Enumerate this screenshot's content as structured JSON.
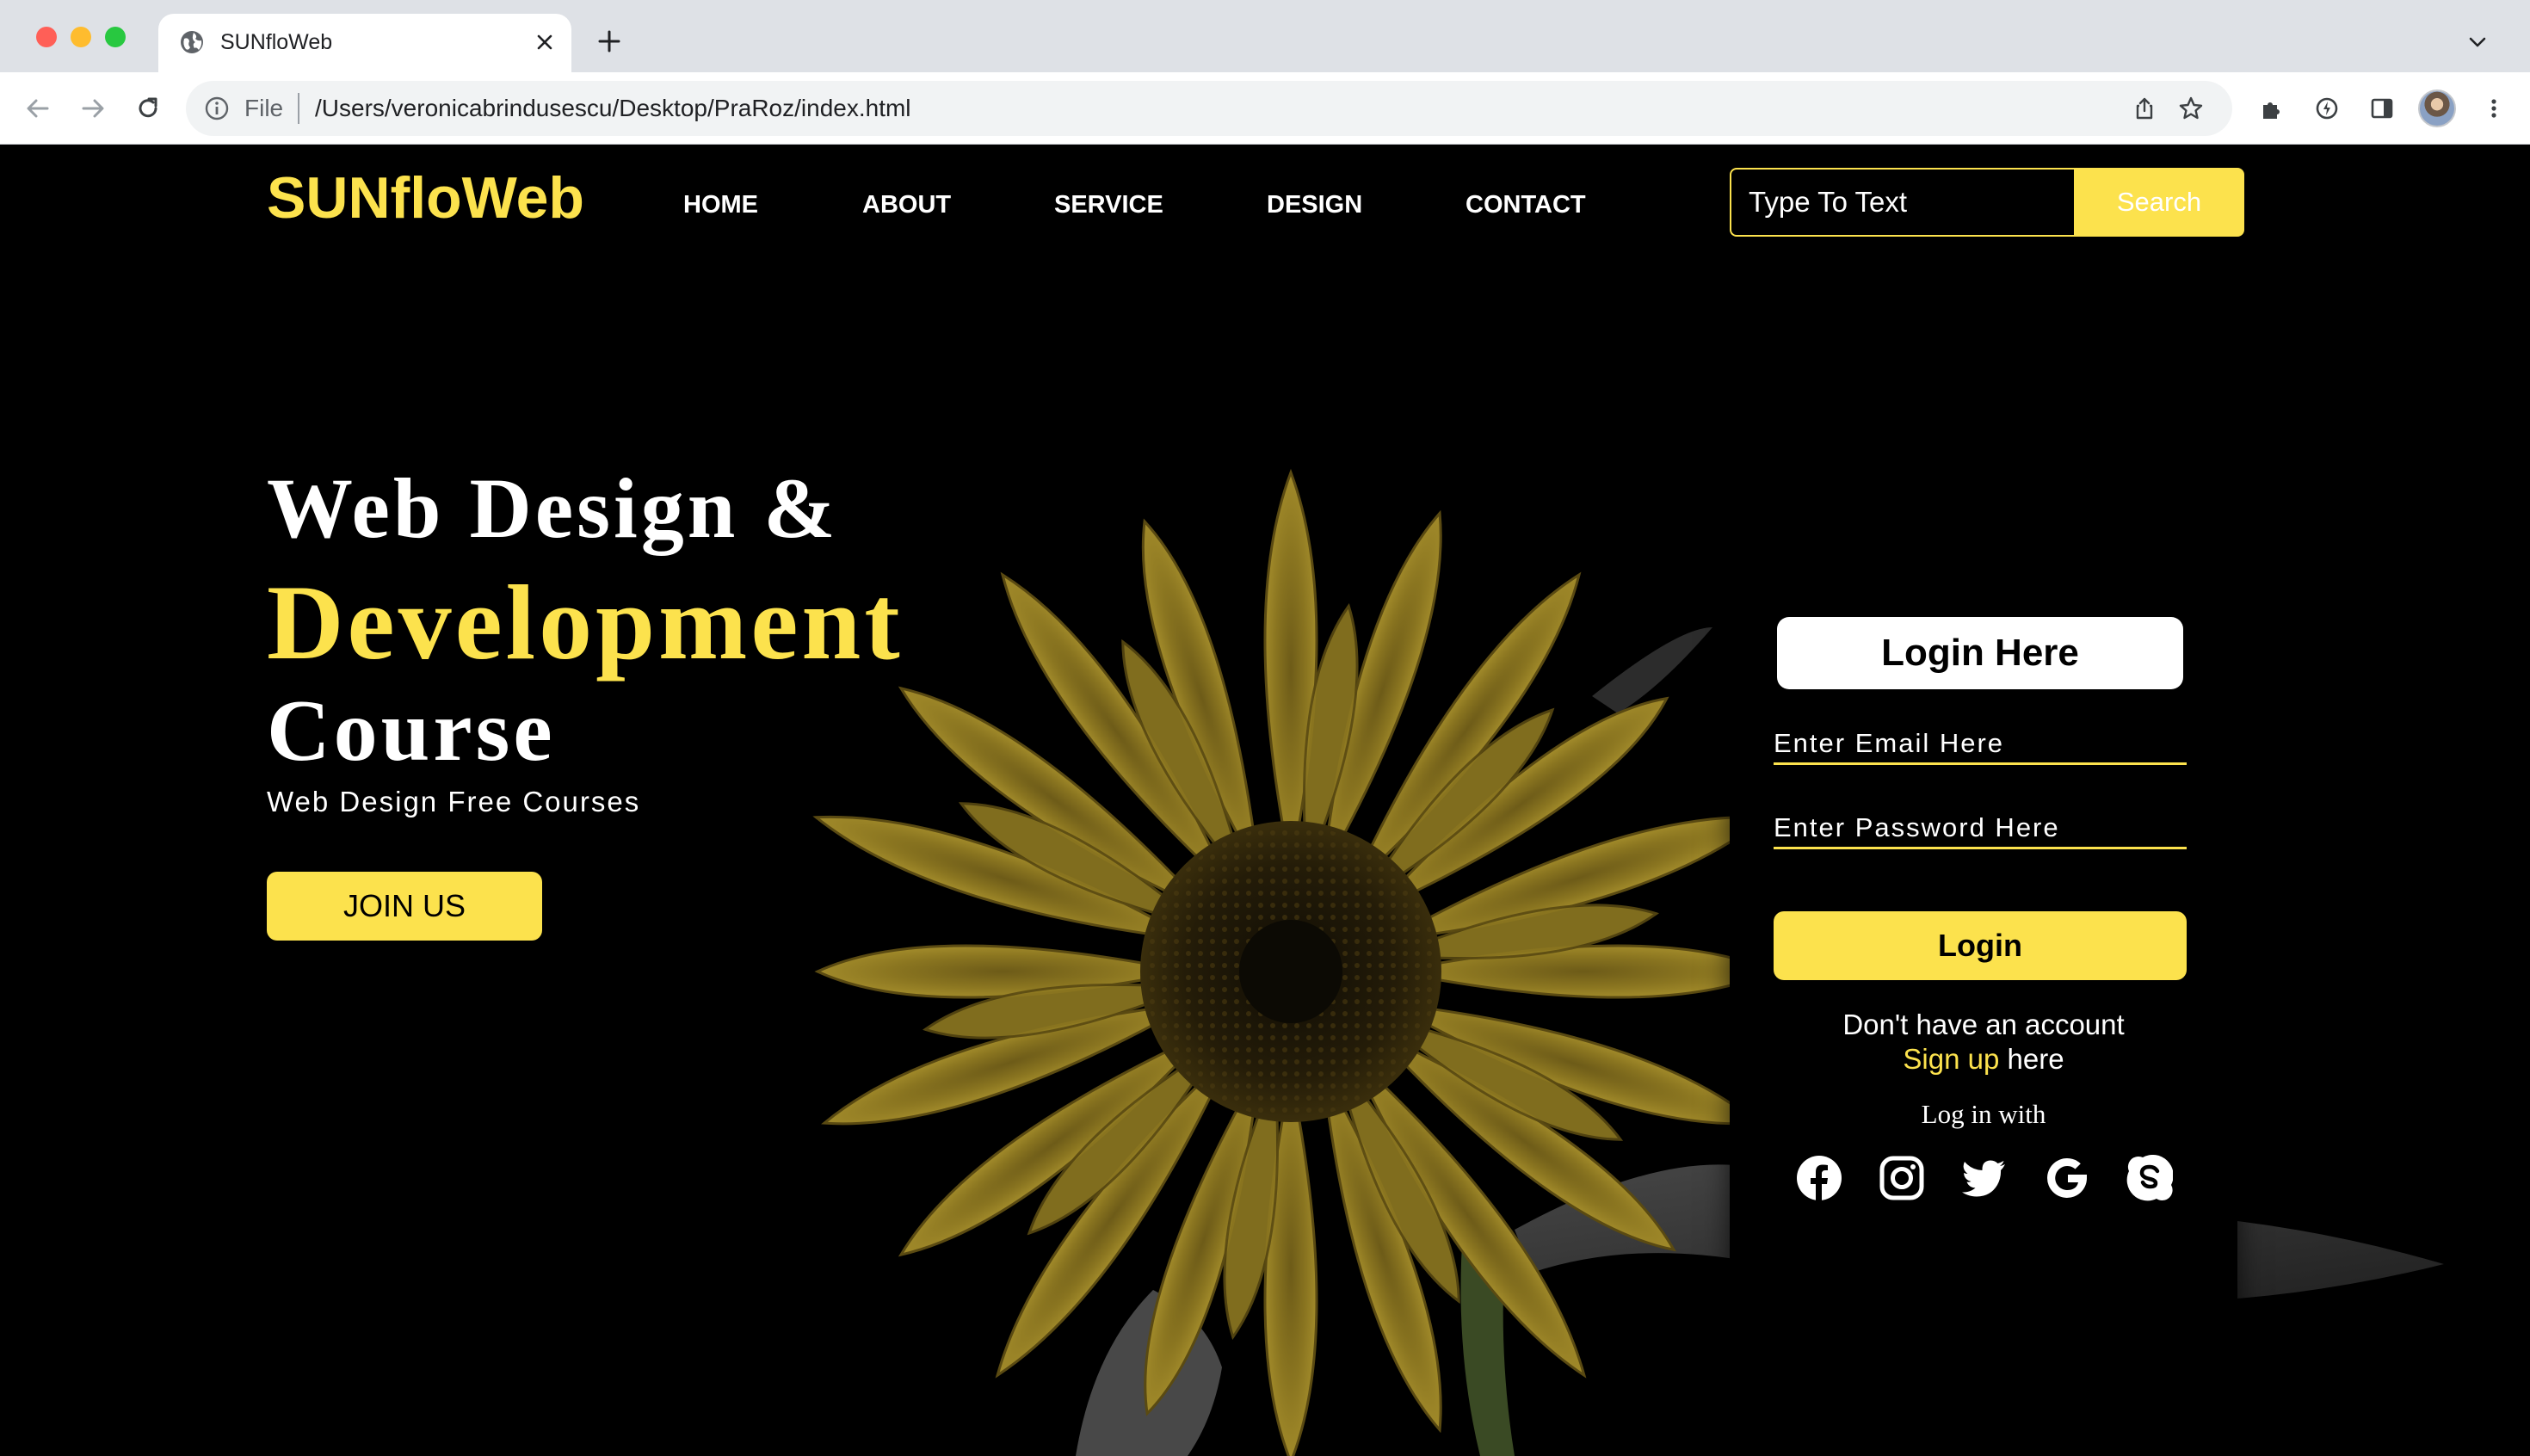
{
  "browser": {
    "tab_title": "SUNfloWeb",
    "scheme_label": "File",
    "url": "/Users/veronicabrindusescu/Desktop/PraRoz/index.html"
  },
  "header": {
    "brand": "SUNfloWeb",
    "nav": [
      "HOME",
      "ABOUT",
      "SERVICE",
      "DESIGN",
      "CONTACT"
    ],
    "search_placeholder": "Type To Text",
    "search_button": "Search"
  },
  "hero": {
    "line1": "Web Design &",
    "line2": "Development",
    "line3": "Course",
    "subtitle": "Web Design Free Courses",
    "cta": "JOIN US"
  },
  "login": {
    "title": "Login Here",
    "email_placeholder": "Enter Email Here",
    "password_placeholder": "Enter Password Here",
    "button": "Login",
    "no_account": "Don't have an account",
    "signup_link": "Sign up",
    "signup_suffix": " here",
    "login_with": "Log in with",
    "socials": [
      "facebook-icon",
      "instagram-icon",
      "twitter-icon",
      "google-icon",
      "skype-icon"
    ]
  },
  "colors": {
    "accent": "#fce24d",
    "background": "#000000",
    "text": "#ffffff"
  }
}
